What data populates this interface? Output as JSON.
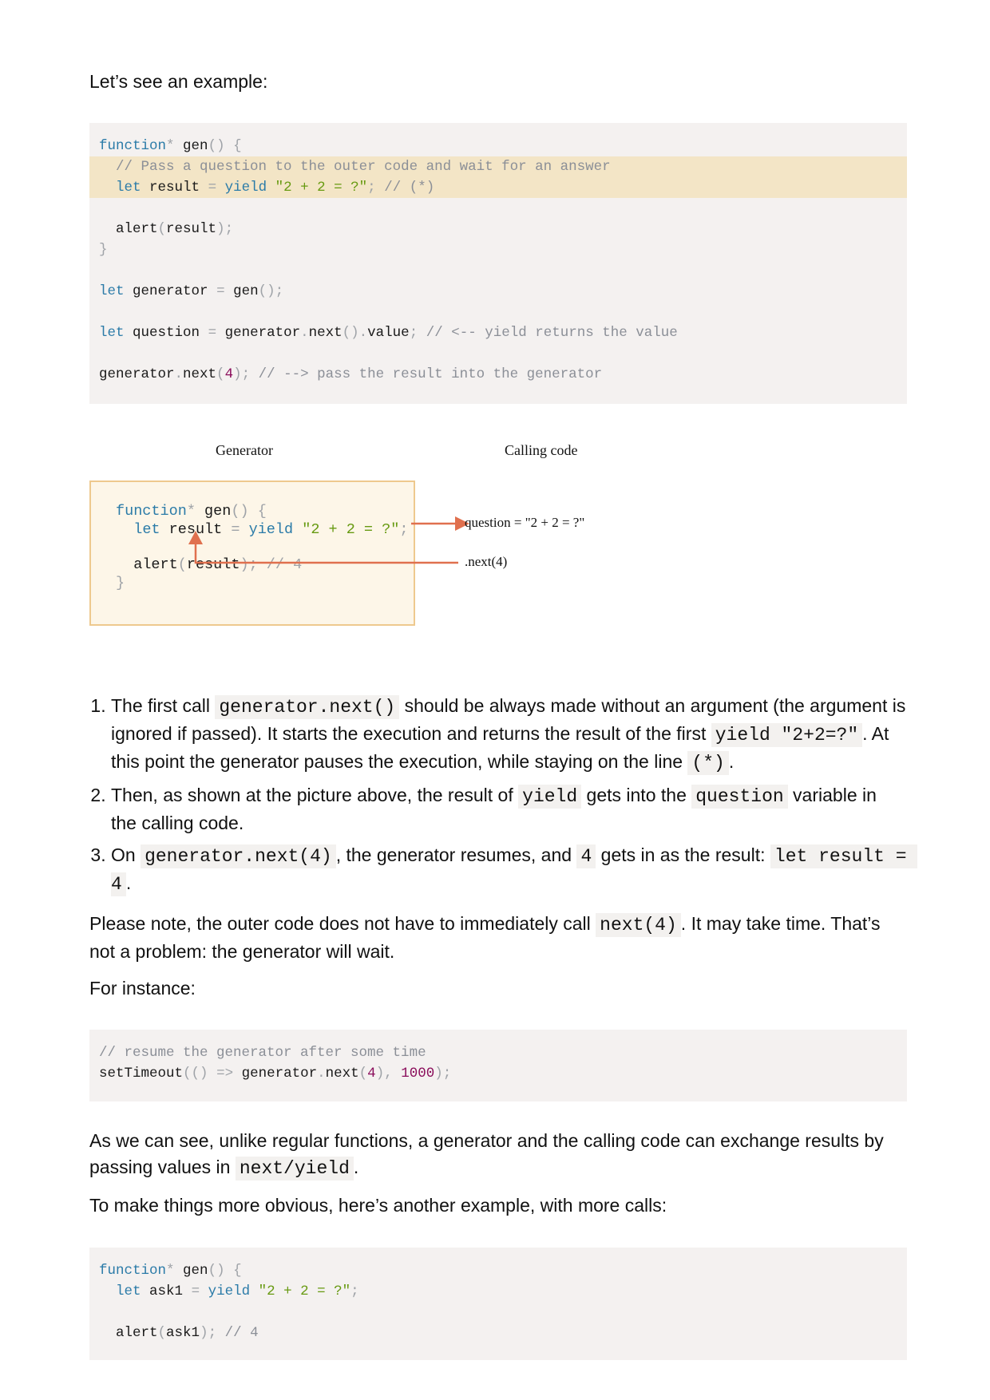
{
  "intro": "Let’s see an example:",
  "code1": {
    "line1": {
      "kw": "function",
      "star": "*",
      "name": "gen",
      "paren": "()",
      "brace": "{"
    },
    "line2": "// Pass a question to the outer code and wait for an answer",
    "line3": {
      "kw": "let",
      "var": "result",
      "eq": "=",
      "yield": "yield",
      "str": "\"2 + 2 = ?\"",
      "semi": ";",
      "comment": "// (*)"
    },
    "line4": {
      "fn": "alert",
      "open": "(",
      "arg": "result",
      "close": ");"
    },
    "line5": "}",
    "line6": {
      "kw": "let",
      "var": "generator",
      "eq": "=",
      "call": "gen",
      "tail": "();"
    },
    "line7": {
      "kw": "let",
      "var": "question",
      "eq": "=",
      "obj": "generator",
      "dot": ".",
      "m": "next",
      "p": "()",
      "dot2": ".",
      "prop": "value",
      "semi": ";",
      "comment": "// <-- yield returns the value"
    },
    "line8": {
      "obj": "generator",
      "dot": ".",
      "m": "next",
      "open": "(",
      "num": "4",
      "close": ");",
      "comment": "// --> pass the result into the generator"
    }
  },
  "diagram": {
    "label_generator": "Generator",
    "label_calling": "Calling code",
    "question_label": "question = \"2 + 2 = ?\"",
    "next_label": ".next(4)",
    "code": {
      "l1": {
        "kw": "function",
        "star": "*",
        "name": "gen",
        "paren": "()",
        "brace": "{"
      },
      "l2": {
        "kw": "let",
        "var": "result",
        "eq": "=",
        "yield": "yield",
        "str": "\"2 + 2 = ?\"",
        "semi": ";"
      },
      "l3": {
        "fn": "alert",
        "open": "(",
        "arg": "result",
        "close": ");",
        "comment": "// 4"
      },
      "l4": "}"
    },
    "arrow_color": "#e0704e"
  },
  "steps": {
    "s1": {
      "t1": "The first call ",
      "c1": "generator.next()",
      "t2": " should be always made without an argument (the argument is ignored if passed). It starts the execution and returns the result of the first ",
      "c2": "yield \"2+2=?\"",
      "t3": ". At this point the generator pauses the execution, while staying on the line ",
      "c3": "(*)",
      "t4": "."
    },
    "s2": {
      "t1": "Then, as shown at the picture above, the result of ",
      "c1": "yield",
      "t2": " gets into the ",
      "c2": "question",
      "t3": " variable in the calling code."
    },
    "s3": {
      "t1": "On ",
      "c1": "generator.next(4)",
      "t2": ", the generator resumes, and ",
      "c2": "4",
      "t3": " gets in as the result: ",
      "c3": "let result = 4",
      "t4": "."
    }
  },
  "note": {
    "t1": "Please note, the outer code does not have to immediately call ",
    "c1": "next(4)",
    "t2": ". It may take time. That’s not a problem: the generator will wait."
  },
  "for_instance": "For instance:",
  "code2": {
    "line1": "// resume the generator after some time",
    "line2": {
      "fn": "setTimeout",
      "open": "((",
      "close": ")",
      "arrow": "=>",
      "obj": "generator",
      "dot": ".",
      "m": "next",
      "o2": "(",
      "num": "4",
      "c2": "),",
      "num2": "1000",
      "end": ");"
    }
  },
  "summary": {
    "t1": "As we can see, unlike regular functions, a generator and the calling code can exchange results by passing values in ",
    "c1": "next/yield",
    "t2": "."
  },
  "another": "To make things more obvious, here’s another example, with more calls:",
  "code3": {
    "line1": {
      "kw": "function",
      "star": "*",
      "name": "gen",
      "paren": "()",
      "brace": "{"
    },
    "line2": {
      "kw": "let",
      "var": "ask1",
      "eq": "=",
      "yield": "yield",
      "str": "\"2 + 2 = ?\"",
      "semi": ";"
    },
    "line3": {
      "fn": "alert",
      "open": "(",
      "arg": "ask1",
      "close": ");",
      "comment": "// 4"
    }
  }
}
